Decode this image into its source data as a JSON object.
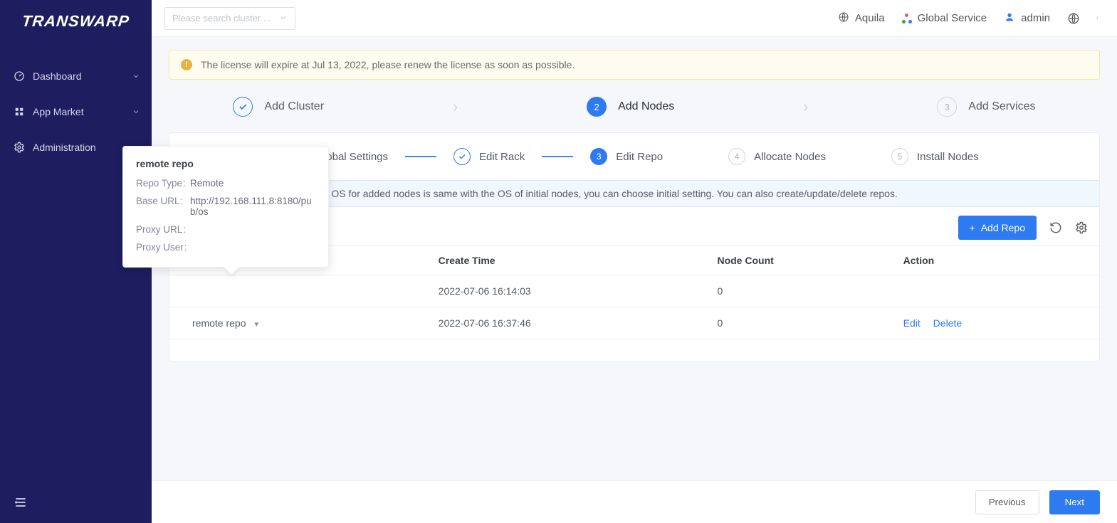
{
  "header": {
    "search_placeholder": "Please search cluster ...",
    "aquila": "Aquila",
    "global_service": "Global Service",
    "user": "admin"
  },
  "sidebar": {
    "items": [
      "Dashboard",
      "App Market",
      "Administration"
    ]
  },
  "warning": "The license will expire at Jul 13, 2022, please renew the license as soon as possible.",
  "wizard": [
    {
      "label": "Add Cluster",
      "state": "done"
    },
    {
      "label": "Add Nodes",
      "state": "active",
      "num": "2"
    },
    {
      "label": "Add Services",
      "state": "todo",
      "num": "3"
    }
  ],
  "substeps": [
    {
      "label": "Global Settings",
      "state": "done"
    },
    {
      "label": "Edit Rack",
      "state": "done"
    },
    {
      "label": "Edit Repo",
      "state": "active",
      "num": "3"
    },
    {
      "label": "Allocate Nodes",
      "state": "todo",
      "num": "4"
    },
    {
      "label": "Install Nodes",
      "state": "todo",
      "num": "5"
    }
  ],
  "info_text": "d setup different Repos. If current OS for added nodes is same with the OS of initial nodes, you can choose initial setting. You can also create/update/delete repos.",
  "toolbar": {
    "add_repo": "Add Repo"
  },
  "table": {
    "headers": {
      "create_time": "Create Time",
      "node_count": "Node Count",
      "action": "Action"
    },
    "rows": [
      {
        "name": "",
        "create_time": "2022-07-06 16:14:03",
        "node_count": "0",
        "edit": "",
        "delete": ""
      },
      {
        "name": "remote repo",
        "create_time": "2022-07-06 16:37:46",
        "node_count": "0",
        "edit": "Edit",
        "delete": "Delete"
      }
    ]
  },
  "footer": {
    "previous": "Previous",
    "next": "Next"
  },
  "tooltip": {
    "title": "remote repo",
    "repo_type_label": "Repo Type",
    "repo_type_value": "Remote",
    "base_url_label": "Base URL",
    "base_url_value": "http://192.168.111.8:8180/pub/os",
    "proxy_url_label": "Proxy URL",
    "proxy_url_value": "",
    "proxy_user_label": "Proxy User",
    "proxy_user_value": ""
  }
}
